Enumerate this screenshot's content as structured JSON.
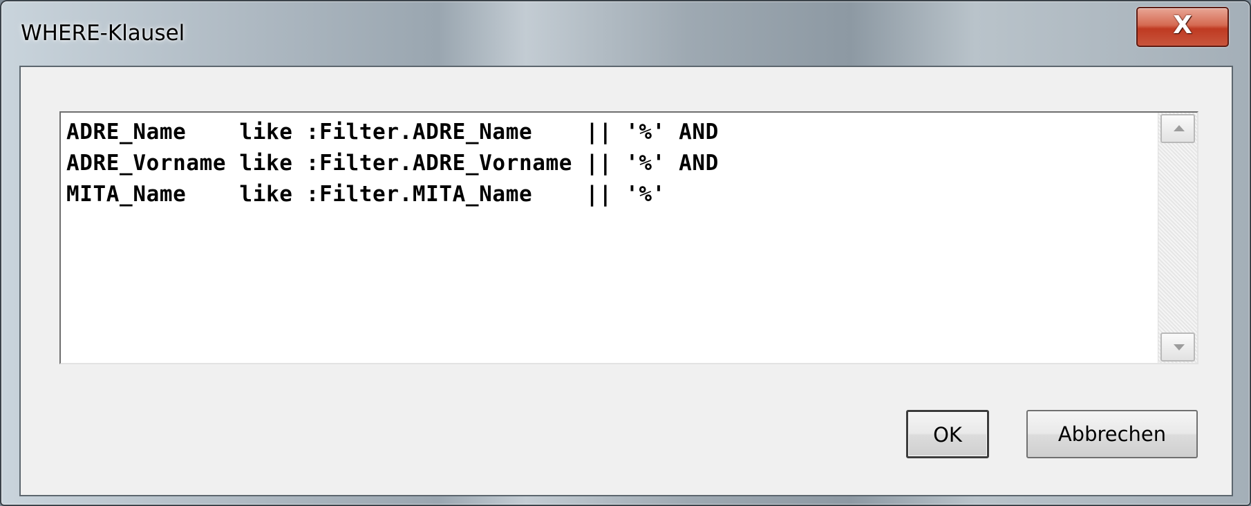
{
  "window": {
    "title": "WHERE-Klausel",
    "close_label": "X"
  },
  "editor": {
    "lines": [
      "ADRE_Name    like :Filter.ADRE_Name    || '%' AND",
      "ADRE_Vorname like :Filter.ADRE_Vorname || '%' AND",
      "MITA_Name    like :Filter.MITA_Name    || '%'"
    ],
    "scroll_up_icon": "triangle-up",
    "scroll_down_icon": "triangle-down"
  },
  "buttons": {
    "ok_label": "OK",
    "cancel_label": "Abbrechen"
  },
  "colors": {
    "close_button": "#c8553c",
    "dialog_background": "#f0f0f0"
  }
}
